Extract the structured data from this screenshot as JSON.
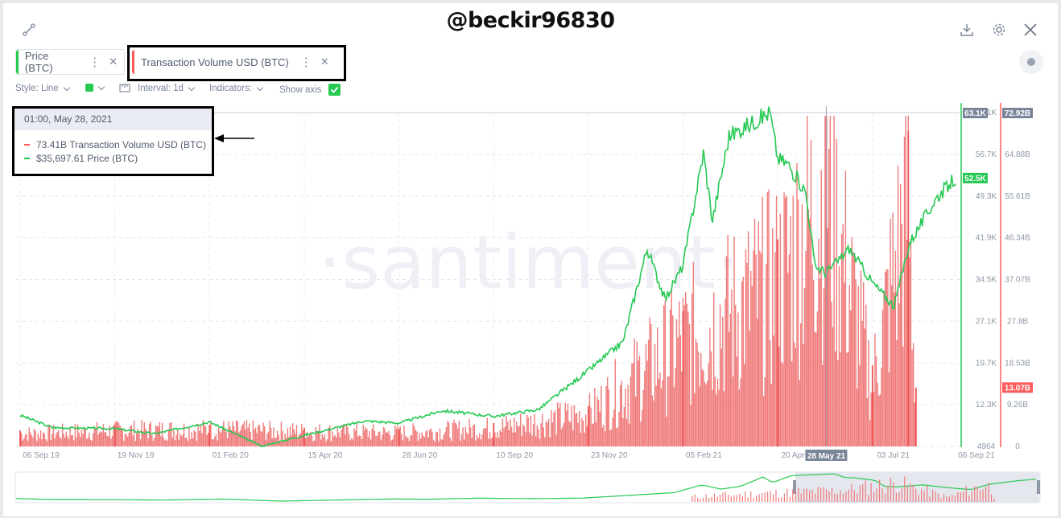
{
  "header": {
    "watermark_handle": "@beckir96830"
  },
  "tabs": [
    {
      "label": "Price (BTC)",
      "color": "#26c953"
    },
    {
      "label": "Transaction Volume USD (BTC)",
      "color": "#ff5b5b"
    }
  ],
  "controls": {
    "style_label": "Style: Line",
    "interval_label": "Interval: 1d",
    "indicators_label": "Indicators:",
    "show_axis_label": "Show axis",
    "show_axis_checked": true
  },
  "tooltip": {
    "date": "01:00, May 28, 2021",
    "volume_text": "73.41B",
    "volume_series": "Transaction Volume USD (BTC)",
    "price_text": "$35,697.61",
    "price_series": "Price (BTC)"
  },
  "chart_data": {
    "type": "bar",
    "watermark": "·santiment·",
    "x_tick_labels": [
      "06 Sep 19",
      "19 Nov 19",
      "01 Feb 20",
      "15 Apr 20",
      "28 Jun 20",
      "10 Sep 20",
      "23 Nov 20",
      "05 Feb 21",
      "20 Apr 21",
      "03 Jul 21",
      "06 Sep 21"
    ],
    "highlighted_x_label": "28 May 21",
    "price_axis": {
      "ticks": [
        "64.1K",
        "56.7K",
        "49.3K",
        "41.9K",
        "34.5K",
        "27.1K",
        "19.7K",
        "12.3K",
        "4964"
      ],
      "ylim": [
        4964,
        64100
      ],
      "current_label": "52.5K",
      "top_label": "63.1K",
      "color": "#26c953"
    },
    "volume_axis": {
      "ticks": [
        "74.15B",
        "64.88B",
        "55.61B",
        "46.34B",
        "37.07B",
        "27.8B",
        "18.53B",
        "9.26B",
        "0"
      ],
      "ylim": [
        0,
        74150000000
      ],
      "current_label": "13.07B",
      "top_label": "72.92B",
      "color": "#ff5b5b"
    },
    "series": [
      {
        "name": "Price (BTC)",
        "kind": "line",
        "points": [
          [
            "06 Sep 19",
            10500
          ],
          [
            "01 Oct 19",
            8300
          ],
          [
            "19 Nov 19",
            8100
          ],
          [
            "20 Dec 19",
            7200
          ],
          [
            "01 Feb 20",
            9300
          ],
          [
            "13 Mar 20",
            5000
          ],
          [
            "15 Apr 20",
            6900
          ],
          [
            "01 Jun 20",
            9500
          ],
          [
            "28 Jun 20",
            9100
          ],
          [
            "01 Aug 20",
            11300
          ],
          [
            "10 Sep 20",
            10300
          ],
          [
            "15 Oct 20",
            11500
          ],
          [
            "23 Nov 20",
            18400
          ],
          [
            "20 Dec 20",
            23500
          ],
          [
            "08 Jan 21",
            40000
          ],
          [
            "22 Jan 21",
            31000
          ],
          [
            "05 Feb 21",
            37000
          ],
          [
            "21 Feb 21",
            57000
          ],
          [
            "28 Feb 21",
            45000
          ],
          [
            "13 Mar 21",
            60000
          ],
          [
            "20 Apr 21",
            56000
          ],
          [
            "14 Apr 21",
            64100
          ],
          [
            "28 Apr 21",
            55000
          ],
          [
            "12 May 21",
            50000
          ],
          [
            "19 May 21",
            37000
          ],
          [
            "28 May 21",
            35697
          ],
          [
            "15 Jun 21",
            40000
          ],
          [
            "20 Jul 21",
            29800
          ],
          [
            "03 Jul 21",
            34000
          ],
          [
            "01 Aug 21",
            41000
          ],
          [
            "22 Aug 21",
            49000
          ],
          [
            "06 Sep 21",
            52500
          ]
        ]
      },
      {
        "name": "Transaction Volume USD (BTC)",
        "kind": "bar",
        "points": [
          [
            "06 Sep 19",
            3500000000
          ],
          [
            "19 Nov 19",
            4500000000
          ],
          [
            "01 Feb 20",
            4800000000
          ],
          [
            "15 Apr 20",
            4200000000
          ],
          [
            "28 Jun 20",
            3800000000
          ],
          [
            "10 Sep 20",
            5200000000
          ],
          [
            "23 Nov 20",
            9000000000
          ],
          [
            "05 Feb 21",
            30000000000
          ],
          [
            "20 Apr 21",
            46000000000
          ],
          [
            "28 May 21",
            73410000000
          ],
          [
            "03 Jul 21",
            18000000000
          ],
          [
            "31 Jul 21",
            70000000000
          ],
          [
            "06 Aug 21",
            13070000000
          ]
        ]
      }
    ]
  }
}
